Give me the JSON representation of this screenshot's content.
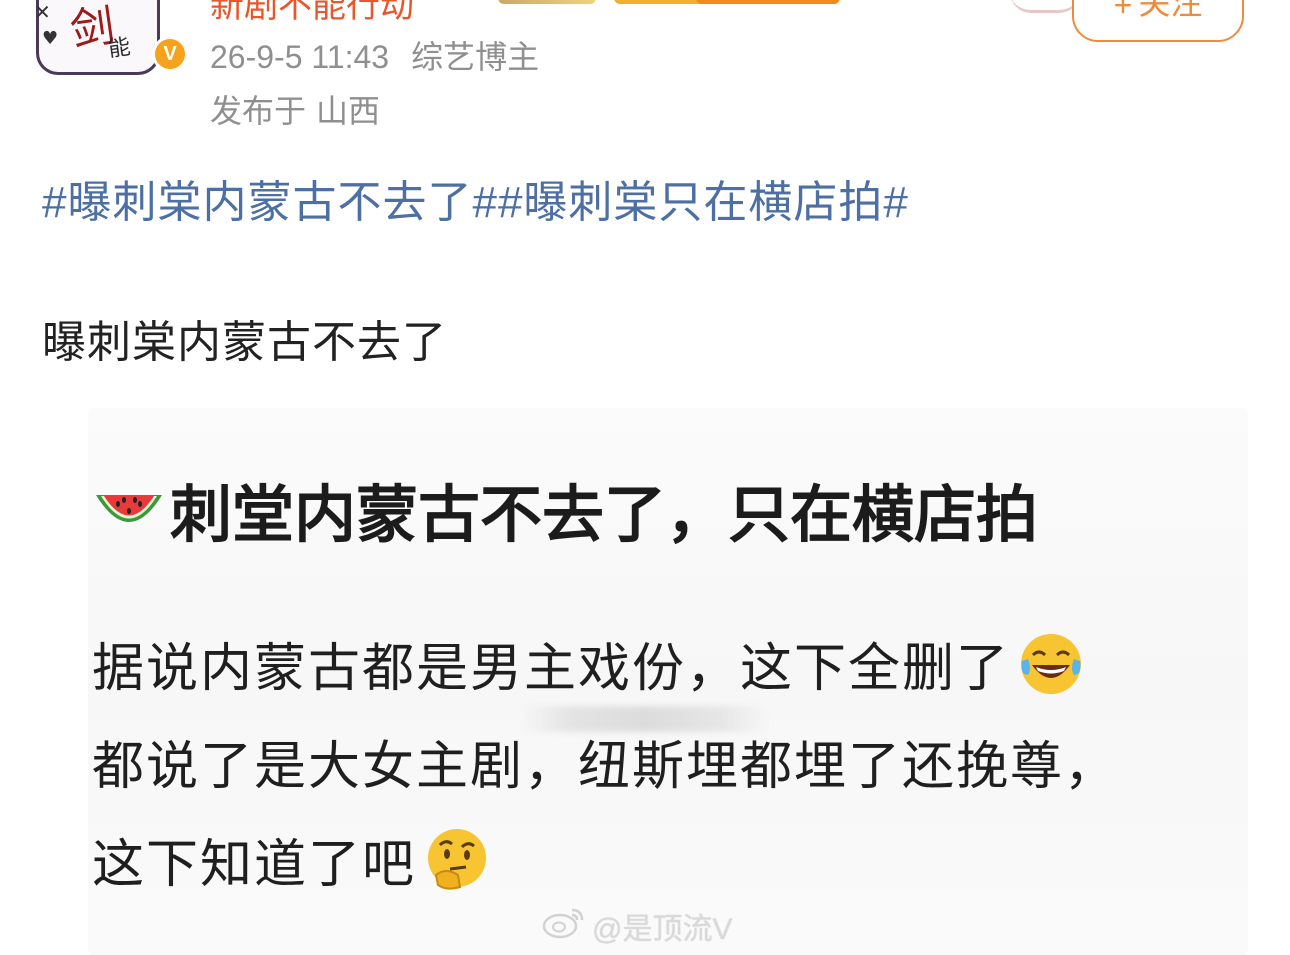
{
  "header": {
    "username": "新剧不能行动",
    "follow_label": "关注",
    "follow_icon": "+",
    "timestamp": "26-9-5 11:43",
    "user_tag": "综艺博主",
    "location_prefix": "发布于",
    "location": "山西",
    "verified_badge": "V"
  },
  "post": {
    "topics": "#曝刺棠内蒙古不去了##曝刺棠只在横店拍#",
    "text": "曝刺棠内蒙古不去了"
  },
  "image_card": {
    "title": "刺堂内蒙古不去了，只在横店拍",
    "lines": [
      "据说内蒙古都是男主戏份，这下全删了",
      "都说了是大女主剧，纽斯埋都埋了还挽尊，",
      "这下知道了吧"
    ],
    "icons": {
      "title_icon": "watermelon-icon",
      "line1_icon": "laughing-tears-icon",
      "line3_icon": "thinking-face-icon"
    }
  },
  "watermark": {
    "text": "@是顶流V",
    "icon": "weibo-logo-icon"
  },
  "colors": {
    "topic_link": "#4d6fa3",
    "meta_gray": "#8f8f8f",
    "follow_orange": "#f08a3c",
    "verified_orange": "#f7a21b"
  }
}
